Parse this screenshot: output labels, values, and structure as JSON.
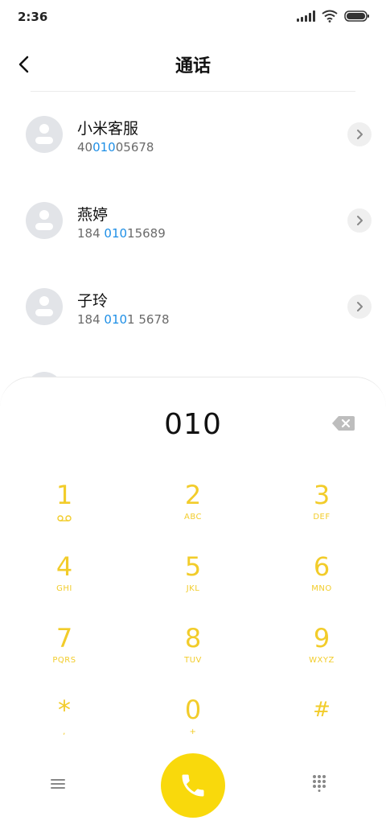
{
  "status_bar": {
    "time": "2:36"
  },
  "header": {
    "title": "通话"
  },
  "contacts": [
    {
      "name": "小米客服",
      "number_pre": "40",
      "number_match": "010",
      "number_post": "05678"
    },
    {
      "name": "燕婷",
      "number_pre": "184 ",
      "number_match": "010",
      "number_post": "15689"
    },
    {
      "name": "子玲",
      "number_pre": "184 ",
      "number_match": "010",
      "number_post": "1 5678"
    }
  ],
  "dialer": {
    "entered_number": "010",
    "keys": [
      {
        "digit": "1",
        "letters": ""
      },
      {
        "digit": "2",
        "letters": "ABC"
      },
      {
        "digit": "3",
        "letters": "DEF"
      },
      {
        "digit": "4",
        "letters": "GHI"
      },
      {
        "digit": "5",
        "letters": "JKL"
      },
      {
        "digit": "6",
        "letters": "MNO"
      },
      {
        "digit": "7",
        "letters": "PQRS"
      },
      {
        "digit": "8",
        "letters": "TUV"
      },
      {
        "digit": "9",
        "letters": "WXYZ"
      },
      {
        "digit": "*",
        "letters": ","
      },
      {
        "digit": "0",
        "letters": "+"
      },
      {
        "digit": "#",
        "letters": ""
      }
    ]
  },
  "colors": {
    "accent": "#f9d90c",
    "key_text": "#f2cc2a",
    "match_highlight": "#1e8fe6"
  },
  "icons": {
    "back": "chevron-left-icon",
    "detail": "chevron-right-icon",
    "backspace": "backspace-icon",
    "voicemail": "voicemail-icon",
    "menu": "menu-icon",
    "call": "phone-icon",
    "keypad": "dialpad-icon"
  }
}
